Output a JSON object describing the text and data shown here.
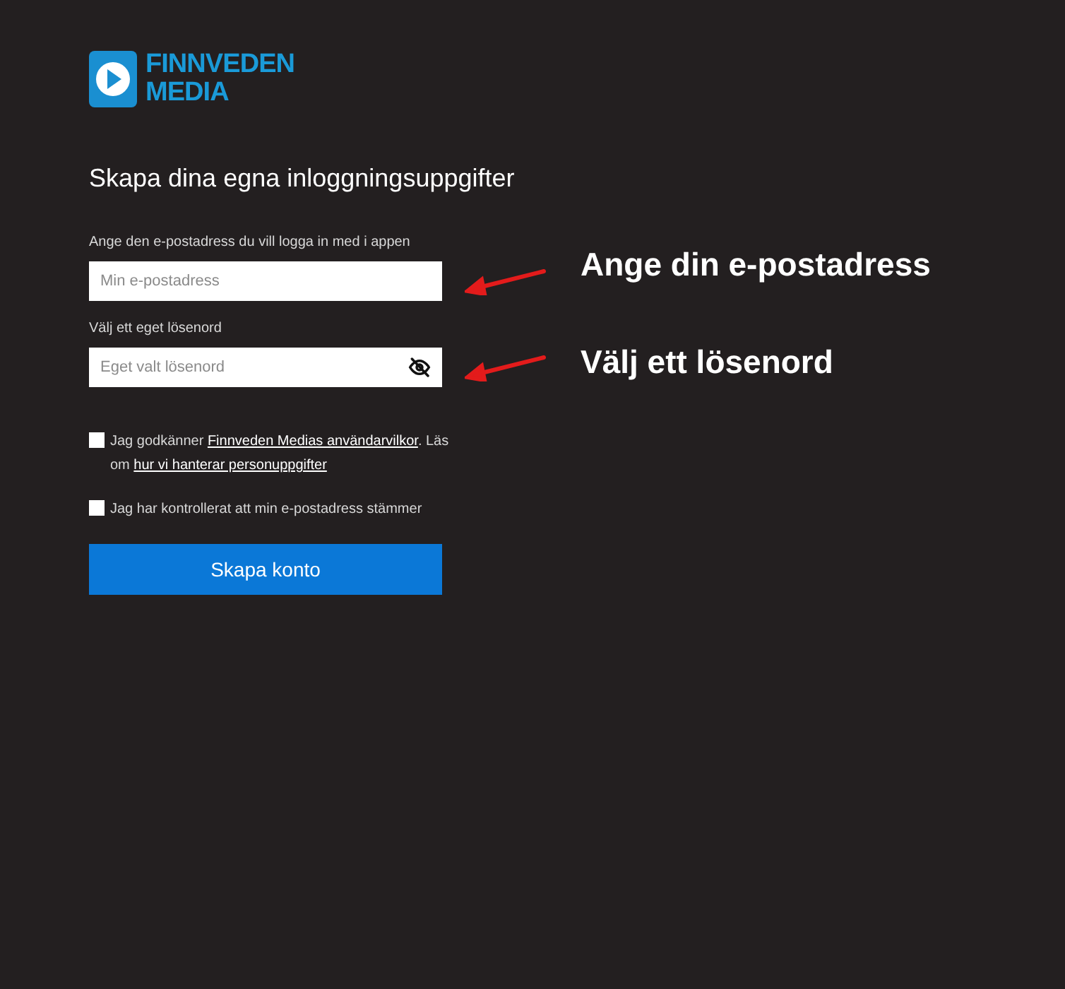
{
  "logo": {
    "line1": "FINNVEDEN",
    "line2": "MEDIA"
  },
  "title": "Skapa dina egna inloggningsuppgifter",
  "fields": [
    {
      "label": "Ange den e-postadress du vill logga in med i appen",
      "placeholder": "Min e-postadress",
      "kind": "email",
      "annotation": "Ange din e-postadress"
    },
    {
      "label": "Välj ett eget lösenord",
      "placeholder": "Eget valt lösenord",
      "kind": "password",
      "annotation": "Välj ett lösenord"
    }
  ],
  "checkboxes": [
    {
      "checked": false,
      "parts": [
        {
          "kind": "text",
          "text": "Jag godkänner "
        },
        {
          "kind": "link",
          "text": "Finnveden Medias användarvilkor"
        },
        {
          "kind": "text",
          "text": ". Läs om "
        },
        {
          "kind": "link",
          "text": "hur vi hanterar personuppgifter"
        }
      ]
    },
    {
      "checked": false,
      "parts": [
        {
          "kind": "text",
          "text": "Jag har kontrollerat att min e-postadress stämmer"
        }
      ]
    }
  ],
  "button": "Skapa konto"
}
